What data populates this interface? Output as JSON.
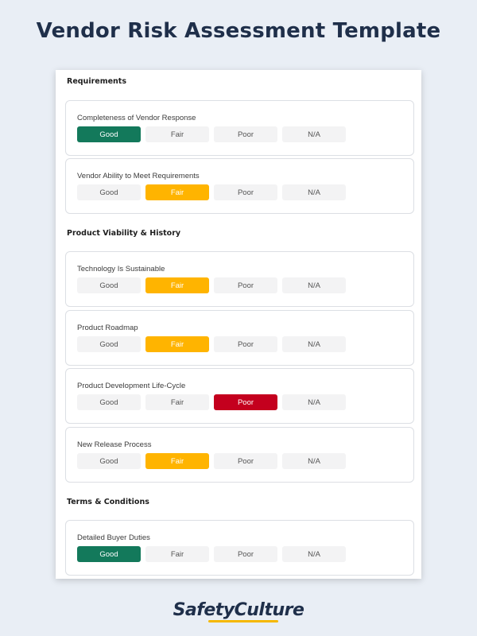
{
  "page_title": "Vendor Risk Assessment Template",
  "brand": "SafetyCulture",
  "options": [
    "Good",
    "Fair",
    "Poor",
    "N/A"
  ],
  "colors": {
    "good": "#13795b",
    "fair": "#ffb400",
    "poor": "#c4001e",
    "unselected": "#f3f3f4"
  },
  "sections": [
    {
      "title": "Requirements",
      "questions": [
        {
          "label": "Completeness of Vendor Response",
          "selected": "Good"
        },
        {
          "label": "Vendor Ability to Meet Requirements",
          "selected": "Fair"
        }
      ]
    },
    {
      "title": "Product Viability & History",
      "questions": [
        {
          "label": "Technology Is Sustainable",
          "selected": "Fair"
        },
        {
          "label": "Product Roadmap",
          "selected": "Fair"
        },
        {
          "label": "Product Development Life-Cycle",
          "selected": "Poor"
        },
        {
          "label": "New Release Process",
          "selected": "Fair"
        }
      ]
    },
    {
      "title": "Terms & Conditions",
      "questions": [
        {
          "label": "Detailed Buyer Duties",
          "selected": "Good"
        }
      ]
    }
  ]
}
